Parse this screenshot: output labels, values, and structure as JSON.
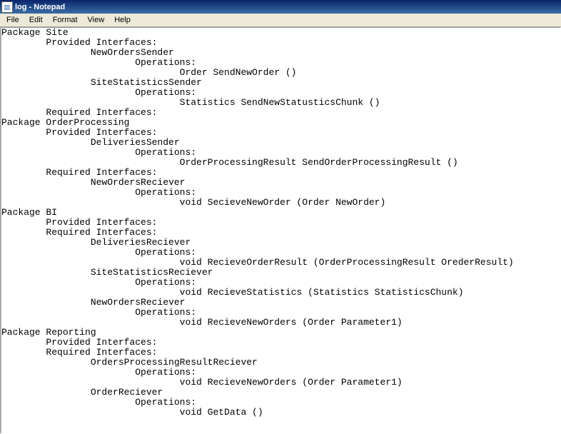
{
  "window": {
    "title": "log - Notepad"
  },
  "menu": {
    "items": [
      "File",
      "Edit",
      "Format",
      "View",
      "Help"
    ]
  },
  "document": {
    "text": "Package Site\n        Provided Interfaces:\n                NewOrdersSender\n                        Operations:\n                                Order SendNewOrder ()\n                SiteStatisticsSender\n                        Operations:\n                                Statistics SendNewStatusticsChunk ()\n        Required Interfaces:\nPackage OrderProcessing\n        Provided Interfaces:\n                DeliveriesSender\n                        Operations:\n                                OrderProcessingResult SendOrderProcessingResult ()\n        Required Interfaces:\n                NewOrdersReciever\n                        Operations:\n                                void SecieveNewOrder (Order NewOrder)\nPackage BI\n        Provided Interfaces:\n        Required Interfaces:\n                DeliveriesReciever\n                        Operations:\n                                void RecieveOrderResult (OrderProcessingResult OrederResult)\n                SiteStatisticsReciever\n                        Operations:\n                                void RecieveStatistics (Statistics StatisticsChunk)\n                NewOrdersReciever\n                        Operations:\n                                void RecieveNewOrders (Order Parameter1)\nPackage Reporting\n        Provided Interfaces:\n        Required Interfaces:\n                OrdersProcessingResultReciever\n                        Operations:\n                                void RecieveNewOrders (Order Parameter1)\n                OrderReciever\n                        Operations:\n                                void GetData ()"
  }
}
